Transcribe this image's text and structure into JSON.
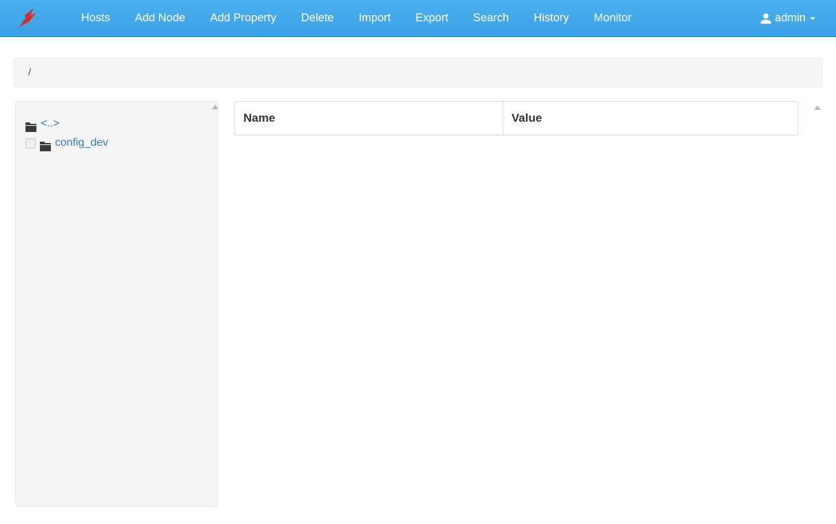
{
  "nav": {
    "items": [
      "Hosts",
      "Add Node",
      "Add Property",
      "Delete",
      "Import",
      "Export",
      "Search",
      "History",
      "Monitor"
    ]
  },
  "user": {
    "name": "admin"
  },
  "breadcrumb": {
    "path": "/"
  },
  "tree": {
    "parent_label": "<..>",
    "items": [
      {
        "label": "config_dev"
      }
    ]
  },
  "table": {
    "headers": {
      "name": "Name",
      "value": "Value"
    },
    "rows": []
  }
}
